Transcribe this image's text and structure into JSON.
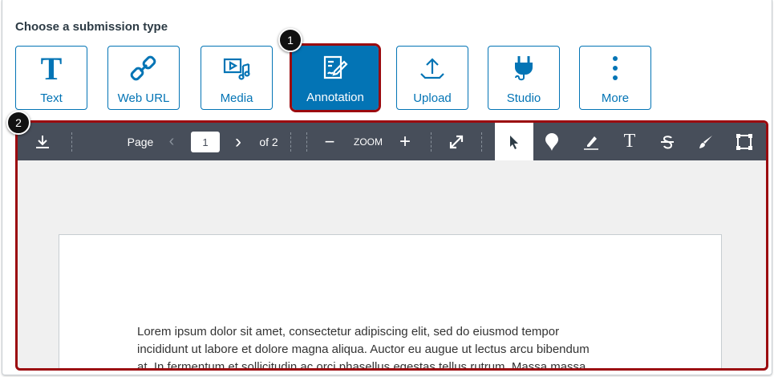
{
  "heading": "Choose a submission type",
  "options": [
    {
      "label": "Text",
      "icon": "text-icon"
    },
    {
      "label": "Web URL",
      "icon": "link-icon"
    },
    {
      "label": "Media",
      "icon": "media-icon"
    },
    {
      "label": "Annotation",
      "icon": "annotation-icon",
      "selected": true
    },
    {
      "label": "Upload",
      "icon": "upload-icon"
    },
    {
      "label": "Studio",
      "icon": "plug-icon"
    },
    {
      "label": "More",
      "icon": "more-vertical-icon"
    }
  ],
  "badges": [
    "1",
    "2"
  ],
  "toolbar": {
    "page_label": "Page",
    "page_value": "1",
    "page_total": "of 2",
    "zoom_label": "ZOOM"
  },
  "document": {
    "lines": [
      "Lorem ipsum dolor sit amet, consectetur adipiscing elit, sed do eiusmod tempor",
      "incididunt ut labore et dolore magna aliqua. Auctor eu augue ut lectus arcu bibendum",
      "at. In fermentum et sollicitudin ac orci phasellus egestas tellus rutrum. Massa massa"
    ]
  },
  "colors": {
    "accent": "#0374b5",
    "highlight": "#9b0a0f",
    "toolbar": "#474e5a"
  }
}
